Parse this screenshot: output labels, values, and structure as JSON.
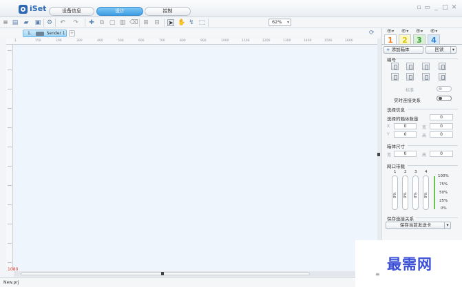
{
  "app": {
    "title": "iSet"
  },
  "main_tabs": [
    {
      "label": "设备信息",
      "active": false
    },
    {
      "label": "设计",
      "active": true
    },
    {
      "label": "控制",
      "active": false
    }
  ],
  "toolbar": {
    "zoom": "62%",
    "icons": [
      "menu-icon",
      "new-file-icon",
      "open-folder-icon",
      "save-icon",
      "settings-icon",
      "undo-icon",
      "redo-icon",
      "add-icon",
      "copy-icon",
      "paste-icon",
      "delete-icon",
      "clear-icon",
      "group-icon",
      "ungroup-icon",
      "pointer-icon",
      "pan-hand-icon",
      "connect-icon",
      "select-icon"
    ]
  },
  "sender": {
    "index": "1.",
    "name": "Sender 1",
    "add_label": "+"
  },
  "ruler": {
    "ticks": [
      "1",
      "150",
      "200",
      "300",
      "400",
      "500",
      "600",
      "700",
      "800",
      "900",
      "1000",
      "1100",
      "1200",
      "1300",
      "1400",
      "1500",
      "1600"
    ]
  },
  "canvas": {
    "size_label": "1080"
  },
  "status": {
    "file": "New.prj"
  },
  "panel": {
    "screen_tabs": [
      {
        "label": "1",
        "color": "#f07c1a",
        "active": true
      },
      {
        "label": "2",
        "color": "#d9c400",
        "active": false
      },
      {
        "label": "3",
        "color": "#3aa335",
        "active": false
      },
      {
        "label": "4",
        "color": "#2e7fd0",
        "active": false
      }
    ],
    "add_cabinet": "添加箱体",
    "back": "回读",
    "numbering": "编号",
    "standard": "标准",
    "realtime_connect": "实时连接关系",
    "select_info": "选择信息",
    "select_count_label": "选择的箱体数量",
    "select_count": "0",
    "x_label": "X",
    "y_label": "Y",
    "w_label": "宽",
    "h_label": "高",
    "x_value": "0",
    "y_value": "0",
    "w_value": "0",
    "h_value": "0",
    "cabinet_size": "箱体尺寸",
    "cab_w_value": "0",
    "cab_h_value": "0",
    "port_bandwidth": "网口带载",
    "ports": [
      "1",
      "2",
      "3",
      "4"
    ],
    "port_values": [
      "0%",
      "0%",
      "0%",
      "0%"
    ],
    "scale": [
      "100%",
      "75%",
      "50%",
      "25%",
      "0%"
    ],
    "save_connection": "保存连接关系",
    "save_to_card": "保存当前发送卡"
  },
  "watermark": "最需网",
  "colors": {
    "accent": "#3d9de3",
    "canvas": "#eef5fc",
    "watermark": "#3b4fd6",
    "size_label": "#e03b2f"
  }
}
